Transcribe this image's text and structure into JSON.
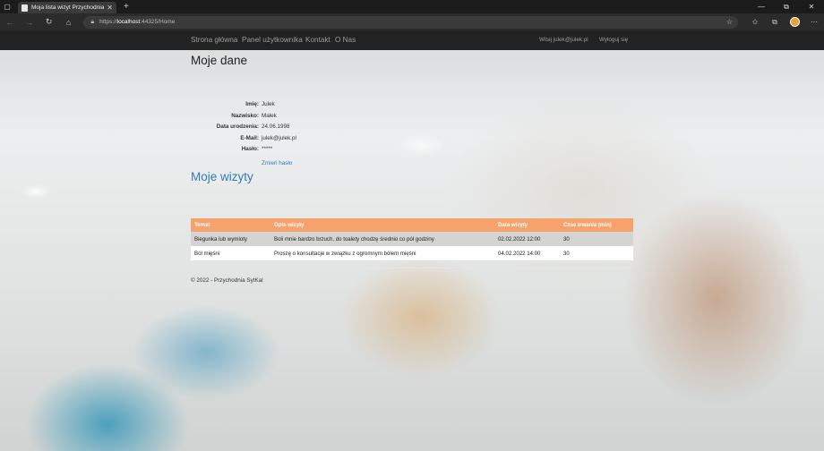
{
  "browser": {
    "tab_title": "Moja lista wizyt Przychodnia SytK",
    "url_scheme": "https://",
    "url_host": "localhost",
    "url_rest": ":44325/Home"
  },
  "nav": {
    "home": "Strona główna",
    "user_panel": "Panel użytkownika",
    "contact": "Kontakt",
    "about": "O Nas",
    "greeting": "Witaj julek@julek.pl",
    "logout": "Wyloguj się"
  },
  "profile": {
    "heading": "Moje dane",
    "fields": [
      {
        "label": "Imię:",
        "value": "Julek"
      },
      {
        "label": "Nazwisko:",
        "value": "Małek"
      },
      {
        "label": "Data urodzenia:",
        "value": "24.06.1998"
      },
      {
        "label": "E-Mail:",
        "value": "julek@julek.pl"
      },
      {
        "label": "Hasło:",
        "value": "*****"
      }
    ],
    "change_password": "Zmień hasło"
  },
  "visits": {
    "heading": "Moje wizyty",
    "columns": [
      "Temat",
      "Opis wizyty",
      "Data wizyty",
      "Czas trwania (min)"
    ],
    "rows": [
      [
        "Biegunka lub wymioty",
        "Boli mnie bardzo brzuch, do toalety chodzę średnio co pół godziny",
        "02.02.2022 12:00",
        "30"
      ],
      [
        "Ból mięśni",
        "Proszę o konsultacje w związku z ogromnym bólem mięśni",
        "04.02.2022 14:00",
        "30"
      ]
    ]
  },
  "footer": "© 2022 - Przychodnia SytKal"
}
